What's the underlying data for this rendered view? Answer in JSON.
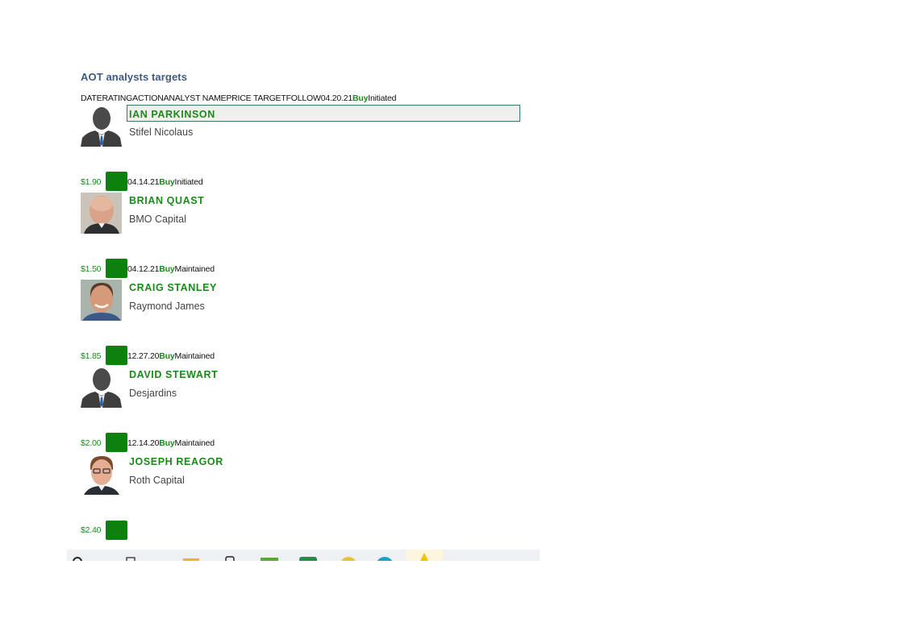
{
  "page": {
    "title": "AOT analysts targets"
  },
  "table_header": {
    "columns": [
      "DATE",
      "RATING",
      "ACTION",
      "ANALYST NAME",
      "PRICE TARGET",
      "FOLLOW"
    ]
  },
  "colors": {
    "title": "#3d5a80",
    "accent_green": "#1b8a1b",
    "follow_button": "#0e800e",
    "highlight_border": "#3d7a5a"
  },
  "rows": [
    {
      "date": "04.20.21",
      "rating": "Buy",
      "action": "Initiated",
      "analyst": "IAN PARKINSON",
      "firm": "Stifel Nicolaus",
      "price_target": "$1.90",
      "avatar": "silhouette-avatar"
    },
    {
      "date": "04.14.21",
      "rating": "Buy",
      "action": "Initiated",
      "analyst": "BRIAN QUAST",
      "firm": "BMO Capital",
      "price_target": "$1.50",
      "avatar": "photo-avatar"
    },
    {
      "date": "04.12.21",
      "rating": "Buy",
      "action": "Maintained",
      "analyst": "CRAIG STANLEY",
      "firm": "Raymond James",
      "price_target": "$1.85",
      "avatar": "photo-avatar"
    },
    {
      "date": "12.27.20",
      "rating": "Buy",
      "action": "Maintained",
      "analyst": "DAVID STEWART",
      "firm": "Desjardins",
      "price_target": "$2.00",
      "avatar": "silhouette-avatar"
    },
    {
      "date": "12.14.20",
      "rating": "Buy",
      "action": "Maintained",
      "analyst": "JOSEPH REAGOR",
      "firm": "Roth Capital",
      "price_target": "$2.40",
      "avatar": "photo-avatar"
    }
  ],
  "taskbar": {
    "icons": [
      "search-icon",
      "task-view-icon",
      "file-explorer-icon",
      "phone-icon",
      "app-icon",
      "spreadsheet-icon",
      "chrome-icon",
      "edge-icon",
      "sticky-notes-icon"
    ]
  }
}
